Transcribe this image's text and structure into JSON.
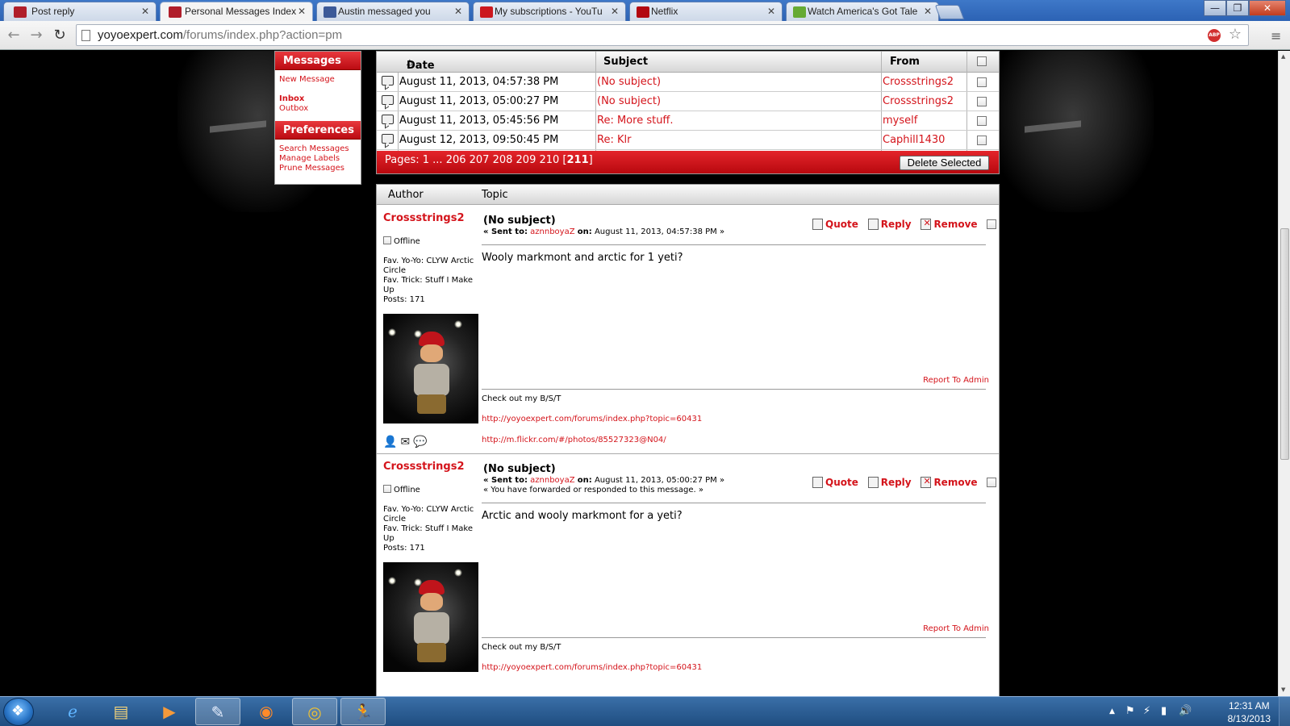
{
  "tabs": [
    {
      "label": "Post reply",
      "icon": "yoyo-icon",
      "color": "#b01e2a"
    },
    {
      "label": "Personal Messages Index",
      "icon": "yoyo-icon",
      "color": "#b01e2a"
    },
    {
      "label": "Austin messaged you",
      "icon": "facebook-icon",
      "color": "#3b5998"
    },
    {
      "label": "My subscriptions - YouTu",
      "icon": "youtube-icon",
      "color": "#cc181e"
    },
    {
      "label": "Netflix",
      "icon": "netflix-icon",
      "color": "#b20710"
    },
    {
      "label": "Watch America's Got Tale",
      "icon": "hulu-icon",
      "color": "#66aa33"
    }
  ],
  "address": {
    "host": "yoyoexpert.com",
    "path": "/forums/index.php?action=pm"
  },
  "adblock_label": "ABP",
  "window_controls": {
    "minimize": "—",
    "restore": "❐",
    "close": "✕"
  },
  "leftmenu": {
    "messages_head": "Messages",
    "new_message": "New Message",
    "inbox": "Inbox",
    "outbox": "Outbox",
    "preferences_head": "Preferences",
    "search": "Search Messages",
    "labels": "Manage Labels",
    "prune": "Prune Messages"
  },
  "pm": {
    "headers": {
      "date": "Date",
      "subject": "Subject",
      "from": "From"
    },
    "rows": [
      {
        "date": "August 11, 2013, 04:57:38 PM",
        "subject": "(No subject)",
        "from": "Crossstrings2"
      },
      {
        "date": "August 11, 2013, 05:00:27 PM",
        "subject": "(No subject)",
        "from": "Crossstrings2"
      },
      {
        "date": "August 11, 2013, 05:45:56 PM",
        "subject": "Re: More stuff.",
        "from": "myself"
      },
      {
        "date": "August 12, 2013, 09:50:45 PM",
        "subject": "Re: Klr",
        "from": "Caphill1430"
      }
    ],
    "pages_prefix": "Pages: 1 ... 206 207 208 209 210 [",
    "pages_current": "211",
    "pages_suffix": "]",
    "delete_button": "Delete Selected"
  },
  "posts_head": {
    "author": "Author",
    "topic": "Topic"
  },
  "posts": [
    {
      "author": "Crossstrings2",
      "status": "Offline",
      "profile_line1": "Fav. Yo-Yo: CLYW Arctic Circle",
      "profile_line2": "Fav. Trick: Stuff I Make Up",
      "profile_line3": "Posts: 171",
      "title": "(No subject)",
      "sent_prefix": "« Sent to:",
      "sent_to": "aznnboyaZ",
      "sent_on": "on:",
      "sent_date": "August 11, 2013, 04:57:38 PM",
      "sent_suffix": "»",
      "note": "",
      "quote": "Quote",
      "reply": "Reply",
      "remove": "Remove",
      "body": "Wooly markmont and arctic for 1 yeti?",
      "report": "Report To Admin",
      "sig": "Check out my B/S/T",
      "sig_link1": "http://yoyoexpert.com/forums/index.php?topic=60431",
      "sig_link2": "http://m.flickr.com/#/photos/85527323@N04/"
    },
    {
      "author": "Crossstrings2",
      "status": "Offline",
      "profile_line1": "Fav. Yo-Yo: CLYW Arctic Circle",
      "profile_line2": "Fav. Trick: Stuff I Make Up",
      "profile_line3": "Posts: 171",
      "title": "(No subject)",
      "sent_prefix": "« Sent to:",
      "sent_to": "aznnboyaZ",
      "sent_on": "on:",
      "sent_date": "August 11, 2013, 05:00:27 PM",
      "sent_suffix": "»",
      "note": "« You have forwarded or responded to this message. »",
      "quote": "Quote",
      "reply": "Reply",
      "remove": "Remove",
      "body": "Arctic and wooly markmont for a yeti?",
      "report": "Report To Admin",
      "sig": "Check out my B/S/T",
      "sig_link1": "http://yoyoexpert.com/forums/index.php?topic=60431",
      "sig_link2": ""
    }
  ],
  "clock": {
    "time": "12:31 AM",
    "date": "8/13/2013"
  },
  "colors": {
    "accent": "#d4141b",
    "taskbar": "#1f4d80"
  }
}
